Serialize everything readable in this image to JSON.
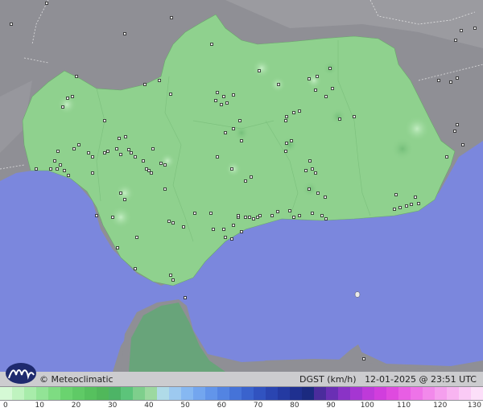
{
  "brand": {
    "name": "Meteoclimatic",
    "logo_icon": "meteoclimatic-logo-icon"
  },
  "variable_label": "DGST (km/h)",
  "timestamp": "12-01-2025 @ 23:51 UTC",
  "colors": {
    "sea": "#7b87dd",
    "land_other": "#8f8f95",
    "region_fill": "#8fd18e",
    "station_marker": "#222222"
  },
  "scale": {
    "unit": "km/h",
    "labels": [
      "0",
      "10",
      "20",
      "30",
      "40",
      "50",
      "60",
      "70",
      "80",
      "90",
      "100",
      "110",
      "120",
      "130"
    ],
    "colors": [
      "#d5f9d5",
      "#bff3bf",
      "#a8ecaa",
      "#92e496",
      "#7edc82",
      "#6ad36f",
      "#5fca66",
      "#56c15e",
      "#50b85a",
      "#4db466",
      "#5cc47a",
      "#7ecf8c",
      "#9cd9a0",
      "#b0dbe8",
      "#9dc9f0",
      "#86b8f2",
      "#73a6ef",
      "#6295ea",
      "#5384e2",
      "#4573d8",
      "#3a63cd",
      "#3153c0",
      "#2a45b1",
      "#243aa2",
      "#1f3090",
      "#1b2a80",
      "#4a2c9c",
      "#6a2fb4",
      "#8a33c6",
      "#a536d2",
      "#be3ad9",
      "#d13edd",
      "#df4adf",
      "#e85ee4",
      "#ee73e8",
      "#f289eb",
      "#f59fee",
      "#f8b4f1",
      "#facaf5",
      "#fcdff9"
    ]
  }
}
